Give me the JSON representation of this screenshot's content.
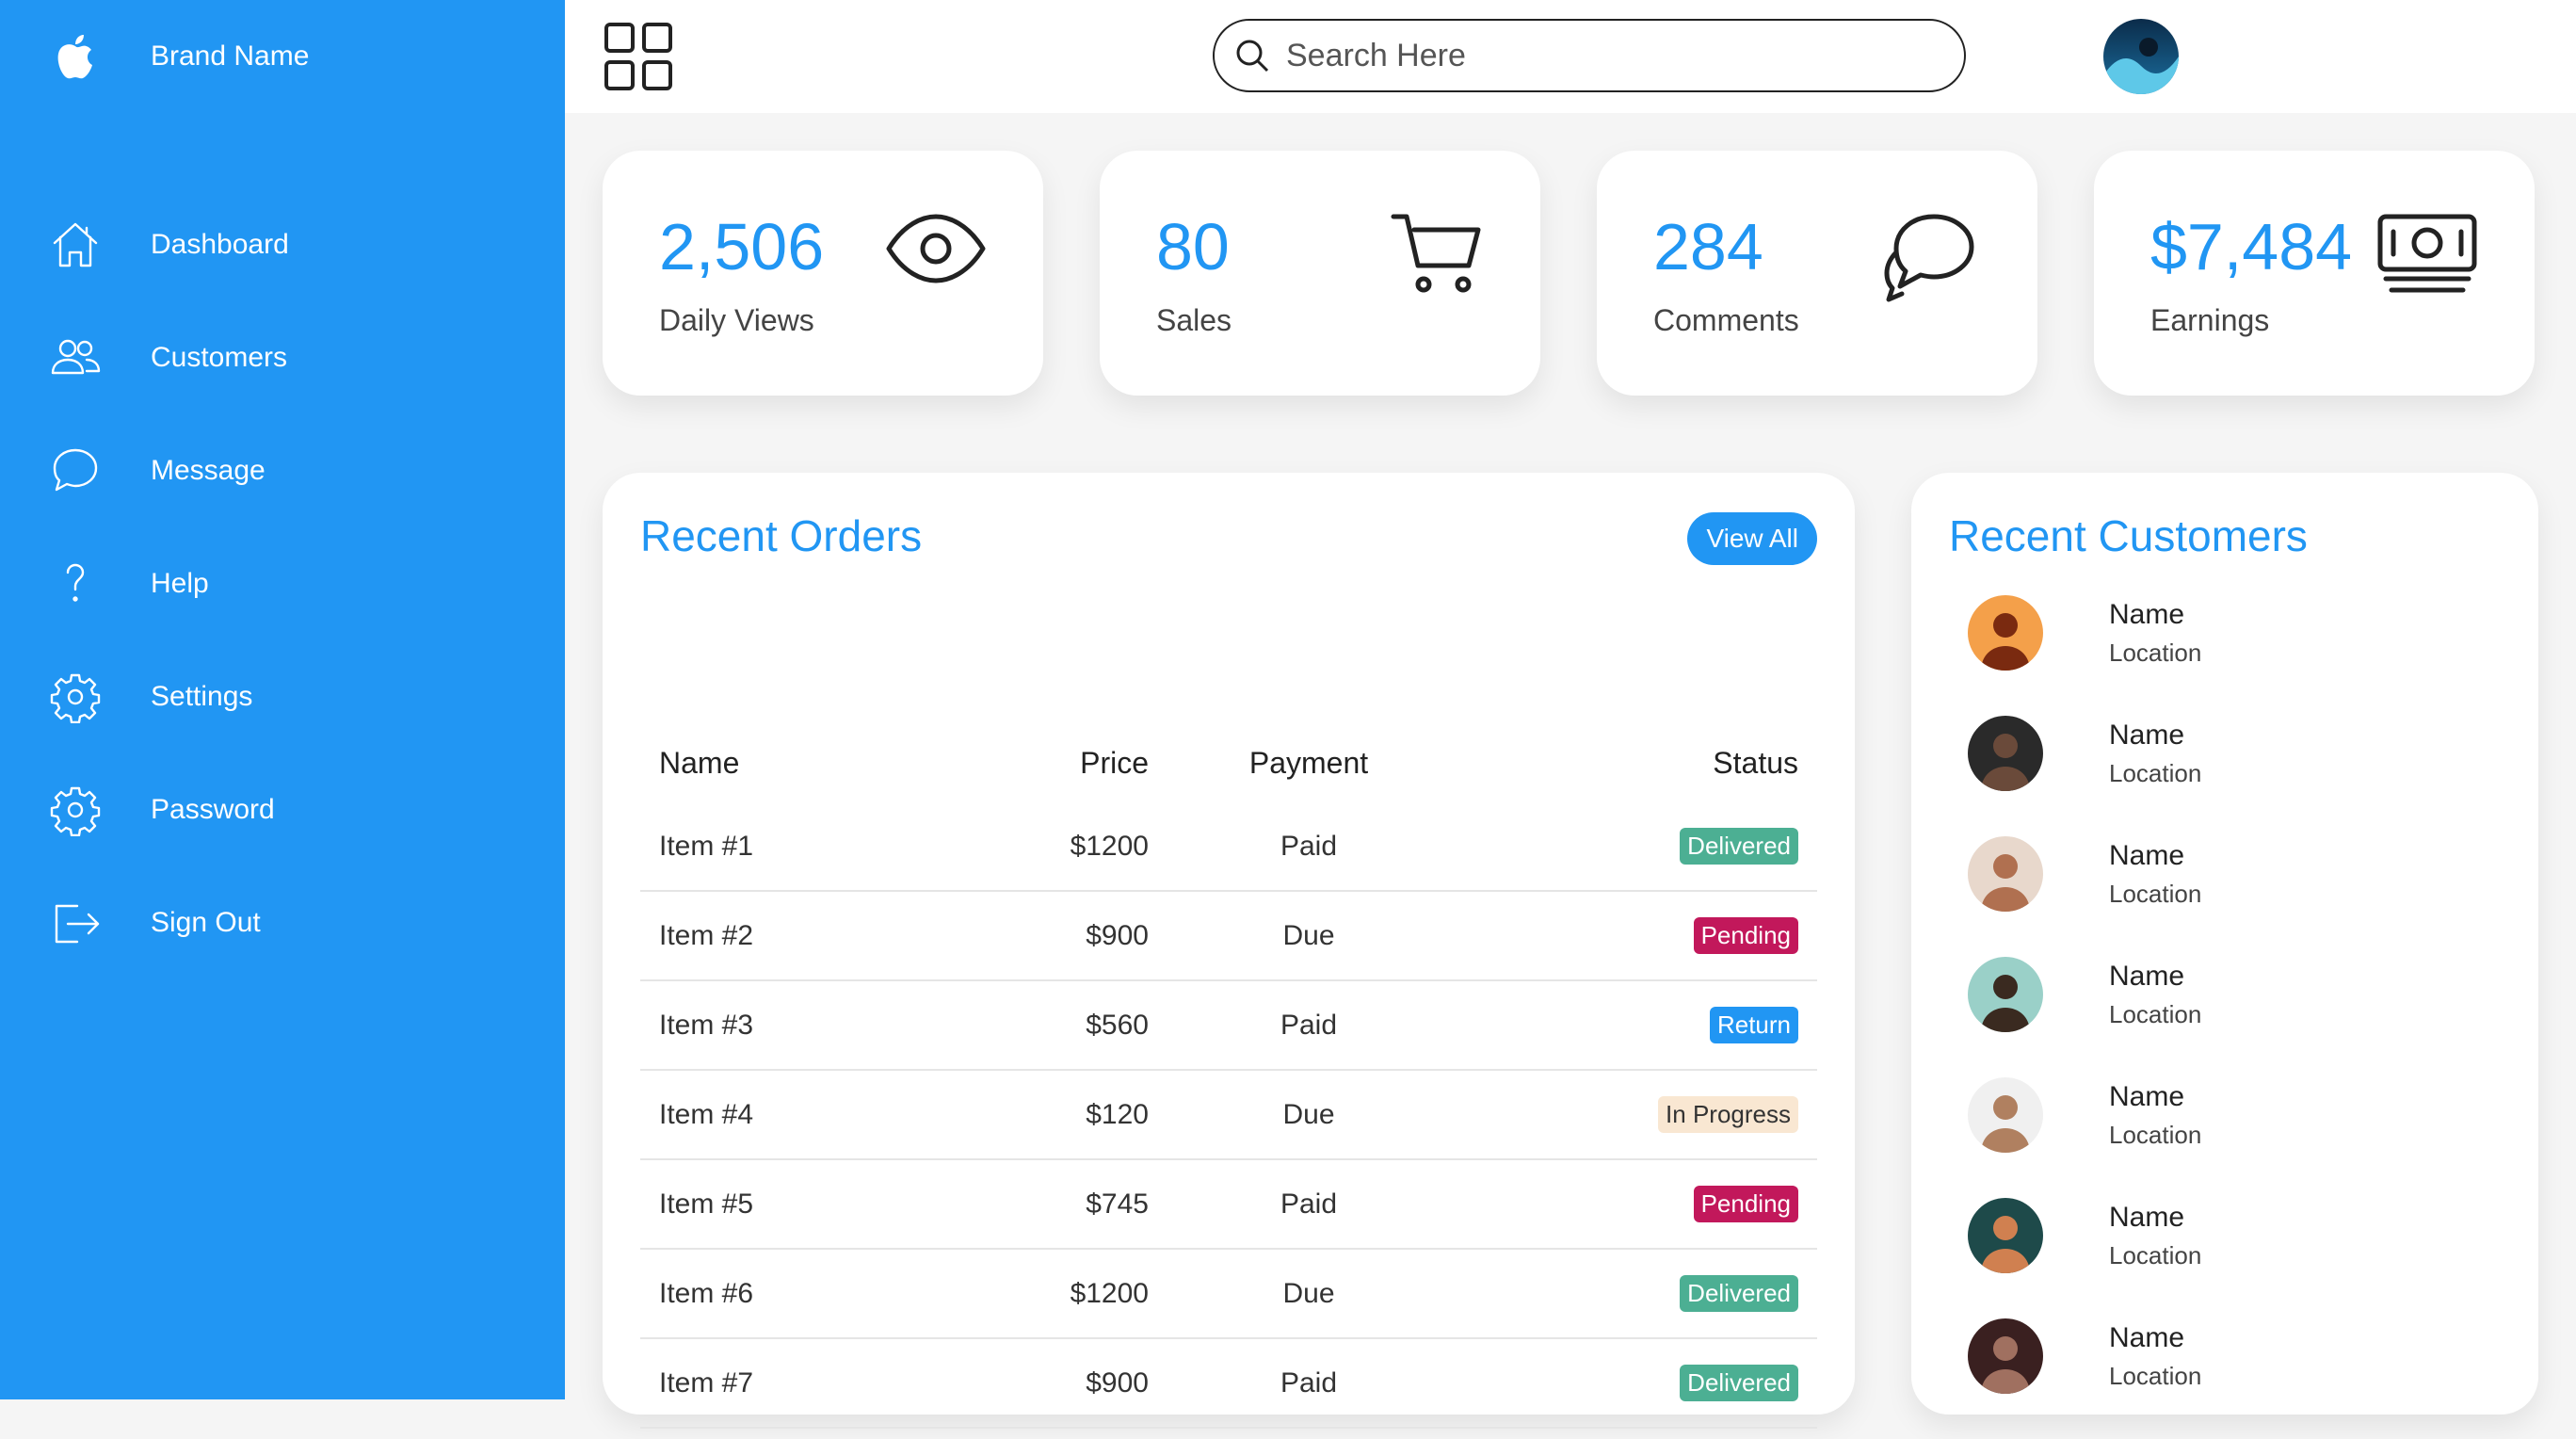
{
  "brand": {
    "name": "Brand Name",
    "icon": "apple-logo-icon"
  },
  "nav": [
    {
      "label": "Dashboard",
      "icon": "home-icon"
    },
    {
      "label": "Customers",
      "icon": "people-icon"
    },
    {
      "label": "Message",
      "icon": "chat-icon"
    },
    {
      "label": "Help",
      "icon": "help-icon"
    },
    {
      "label": "Settings",
      "icon": "gear-icon"
    },
    {
      "label": "Password",
      "icon": "lock-icon"
    },
    {
      "label": "Sign Out",
      "icon": "sign-out-icon"
    }
  ],
  "search": {
    "placeholder": "Search Here"
  },
  "cards": [
    {
      "value": "2,506",
      "label": "Daily Views",
      "icon": "eye-icon"
    },
    {
      "value": "80",
      "label": "Sales",
      "icon": "cart-icon"
    },
    {
      "value": "284",
      "label": "Comments",
      "icon": "chat-bubbles-icon"
    },
    {
      "value": "$7,484",
      "label": "Earnings",
      "icon": "cash-icon"
    }
  ],
  "orders": {
    "title": "Recent Orders",
    "view_all": "View All",
    "headers": {
      "name": "Name",
      "price": "Price",
      "payment": "Payment",
      "status": "Status"
    },
    "rows": [
      {
        "name": "Item #1",
        "price": "$1200",
        "payment": "Paid",
        "status": "Delivered",
        "kind": "delivered"
      },
      {
        "name": "Item #2",
        "price": "$900",
        "payment": "Due",
        "status": "Pending",
        "kind": "pending"
      },
      {
        "name": "Item #3",
        "price": "$560",
        "payment": "Paid",
        "status": "Return",
        "kind": "return"
      },
      {
        "name": "Item #4",
        "price": "$120",
        "payment": "Due",
        "status": "In Progress",
        "kind": "progress"
      },
      {
        "name": "Item #5",
        "price": "$745",
        "payment": "Paid",
        "status": "Pending",
        "kind": "pending"
      },
      {
        "name": "Item #6",
        "price": "$1200",
        "payment": "Due",
        "status": "Delivered",
        "kind": "delivered"
      },
      {
        "name": "Item #7",
        "price": "$900",
        "payment": "Paid",
        "status": "Delivered",
        "kind": "delivered"
      }
    ]
  },
  "customers": {
    "title": "Recent Customers",
    "items": [
      {
        "name": "Name",
        "location": "Location"
      },
      {
        "name": "Name",
        "location": "Location"
      },
      {
        "name": "Name",
        "location": "Location"
      },
      {
        "name": "Name",
        "location": "Location"
      },
      {
        "name": "Name",
        "location": "Location"
      },
      {
        "name": "Name",
        "location": "Location"
      },
      {
        "name": "Name",
        "location": "Location"
      }
    ]
  },
  "colors": {
    "primary": "#2196f3",
    "delivered": "#4caf93",
    "pending": "#c2185b",
    "return": "#2196f3",
    "progress": "#f9e7d2"
  }
}
